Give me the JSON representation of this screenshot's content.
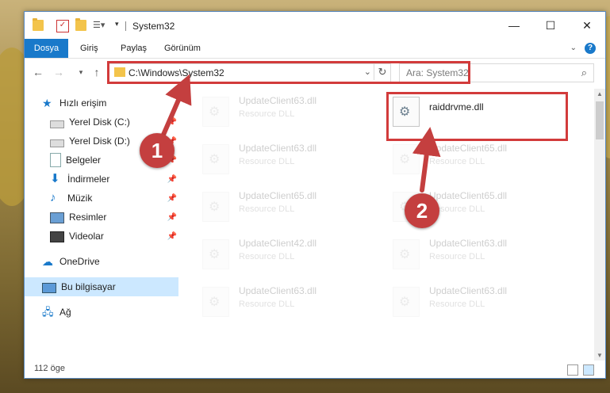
{
  "window": {
    "title": "System32",
    "controls": [
      "—",
      "☐",
      "✕"
    ]
  },
  "ribbon": {
    "tabs": [
      "Dosya",
      "Giriş",
      "Paylaş",
      "Görünüm"
    ],
    "help": "?"
  },
  "navbar": {
    "address": "C:\\Windows\\System32",
    "search_placeholder": "Ara: System32"
  },
  "sidebar": {
    "items": [
      {
        "label": "Hızlı erişim",
        "icon": "star-icon",
        "pinned": false
      },
      {
        "label": "Yerel Disk (C:)",
        "icon": "drive-icon",
        "pinned": true
      },
      {
        "label": "Yerel Disk (D:)",
        "icon": "drive-icon",
        "pinned": true
      },
      {
        "label": "Belgeler",
        "icon": "document-icon",
        "pinned": true
      },
      {
        "label": "İndirmeler",
        "icon": "download-icon",
        "pinned": true
      },
      {
        "label": "Müzik",
        "icon": "music-icon",
        "pinned": true
      },
      {
        "label": "Resimler",
        "icon": "pictures-icon",
        "pinned": true
      },
      {
        "label": "Videolar",
        "icon": "video-icon",
        "pinned": true
      },
      {
        "label": "OneDrive",
        "icon": "cloud-icon",
        "pinned": false
      },
      {
        "label": "Bu bilgisayar",
        "icon": "computer-icon",
        "pinned": false,
        "selected": true
      },
      {
        "label": "Ağ",
        "icon": "network-icon",
        "pinned": false
      }
    ]
  },
  "files": {
    "left_column": [
      {
        "name": "UpdateClient63.dll",
        "type": "Resource DLL"
      },
      {
        "name": "UpdateClient63.dll",
        "type": "Resource DLL"
      },
      {
        "name": "UpdateClient65.dll",
        "type": "Resource DLL"
      },
      {
        "name": "UpdateClient42.dll",
        "type": "Resource DLL"
      },
      {
        "name": "UpdateClient63.dll",
        "type": "Resource DLL"
      }
    ],
    "right_column": [
      {
        "name": "raiddrvme.dll",
        "type": "",
        "highlighted": true
      },
      {
        "name": "UpdateClient65.dll",
        "type": "Resource DLL"
      },
      {
        "name": "UpdateClient65.dll",
        "type": "Resource DLL"
      },
      {
        "name": "UpdateClient63.dll",
        "type": "Resource DLL"
      },
      {
        "name": "UpdateClient63.dll",
        "type": "Resource DLL"
      }
    ]
  },
  "status": {
    "item_count": "112 öge"
  },
  "callouts": [
    "1",
    "2"
  ],
  "colors": {
    "accent": "#1979ca",
    "highlight_box": "#d23b3b",
    "callout": "#c43f3f",
    "selection": "#cce8ff"
  }
}
